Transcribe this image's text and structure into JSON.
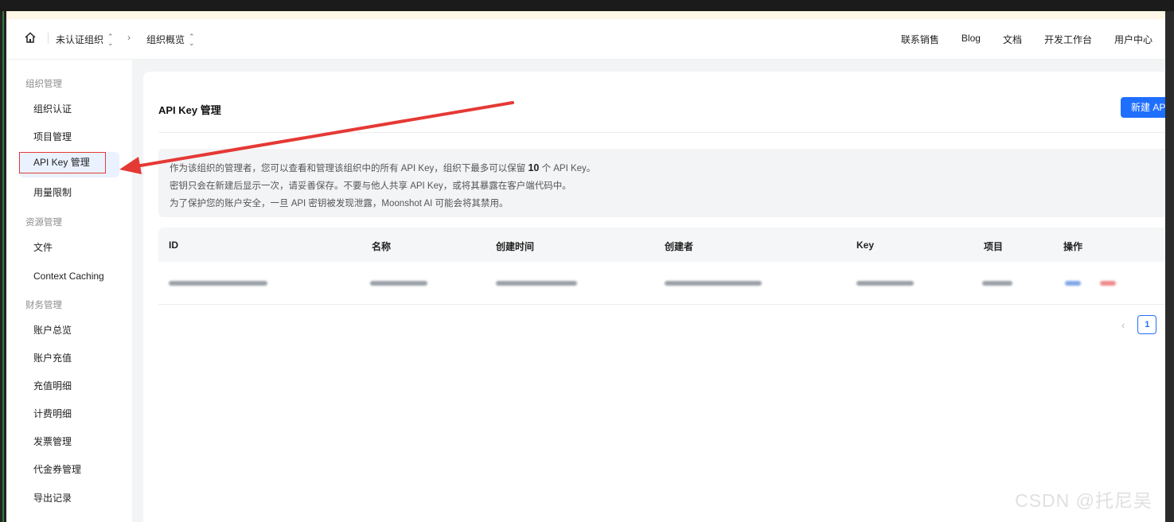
{
  "header": {
    "org_label": "未认证组织",
    "overview_label": "组织概览",
    "nav_links": [
      "联系销售",
      "Blog",
      "文档",
      "开发工作台",
      "用户中心"
    ]
  },
  "sidebar": {
    "groups": [
      {
        "label": "组织管理",
        "items": [
          "组织认证",
          "项目管理",
          "API Key 管理",
          "用量限制"
        ]
      },
      {
        "label": "资源管理",
        "items": [
          "文件",
          "Context Caching"
        ]
      },
      {
        "label": "财务管理",
        "items": [
          "账户总览",
          "账户充值",
          "充值明细",
          "计费明细",
          "发票管理",
          "代金券管理",
          "导出记录"
        ]
      }
    ],
    "active_item": "API Key 管理"
  },
  "main": {
    "title": "API Key 管理",
    "new_button": "新建 API",
    "notice": {
      "line1_prefix": "作为该组织的管理者，您可以查看和管理该组织中的所有 API Key，组织下最多可以保留",
      "line1_count": "10",
      "line1_suffix": "个 API Key。",
      "line2": "密钥只会在新建后显示一次，请妥善保存。不要与他人共享 API Key，或将其暴露在客户端代码中。",
      "line3": "为了保护您的账户安全，一旦 API 密钥被发现泄露，Moonshot AI 可能会将其禁用。"
    },
    "table": {
      "columns": [
        "ID",
        "名称",
        "创建时间",
        "创建者",
        "Key",
        "项目",
        "操作"
      ]
    },
    "pagination": {
      "current_page": "1"
    }
  },
  "watermark": "CSDN @托尼吴",
  "colors": {
    "accent": "#1f6fff",
    "annotation_red": "#e53935"
  }
}
